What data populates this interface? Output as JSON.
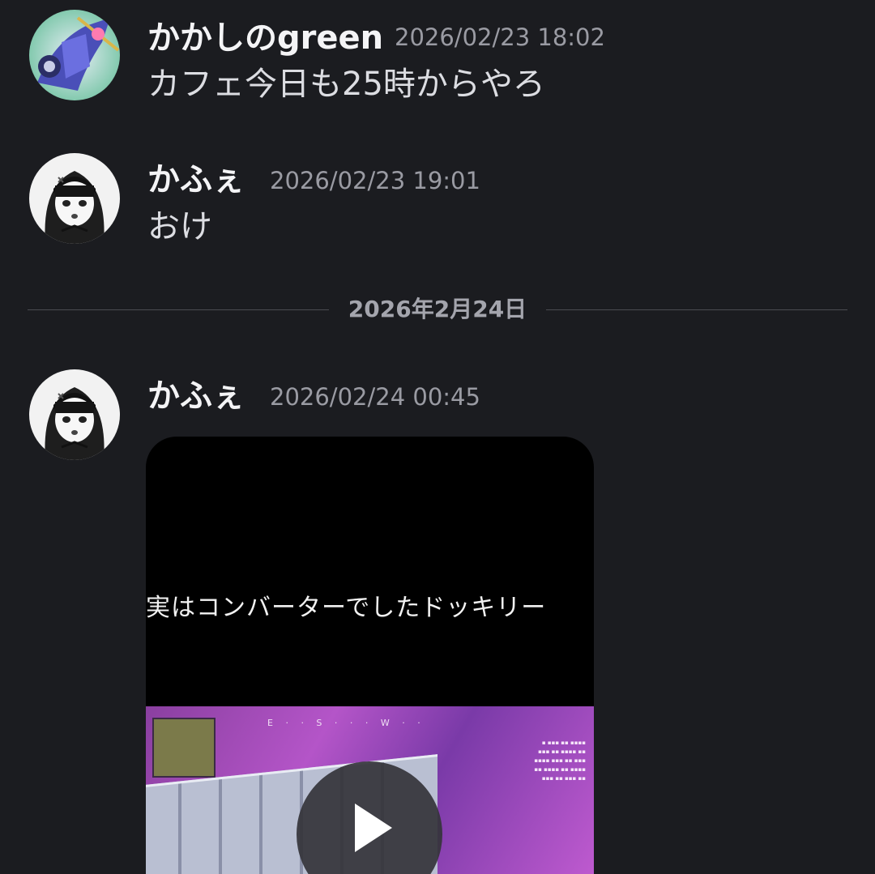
{
  "messages": [
    {
      "author": "かかしのgreen",
      "timestamp": "2026/02/23 18:02",
      "text": "カフェ今日も25時からやろ",
      "avatar_icon": "robot-avatar-icon"
    },
    {
      "author": "かふぇ",
      "timestamp": "2026/02/23 19:01",
      "text": "おけ",
      "avatar_icon": "anime-girl-avatar-icon"
    },
    {
      "author": "かふぇ",
      "timestamp": "2026/02/24 00:45",
      "avatar_icon": "anime-girl-avatar-icon",
      "attachment": {
        "type": "video",
        "caption": "実はコンバーターでしたドッキリー",
        "play_icon": "play-icon"
      }
    }
  ],
  "date_divider": "2026年2月24日",
  "colors": {
    "background": "#1b1c20",
    "author": "#f4f4f6",
    "timestamp": "#9a9ba3",
    "divider_line": "#4a4b52"
  }
}
